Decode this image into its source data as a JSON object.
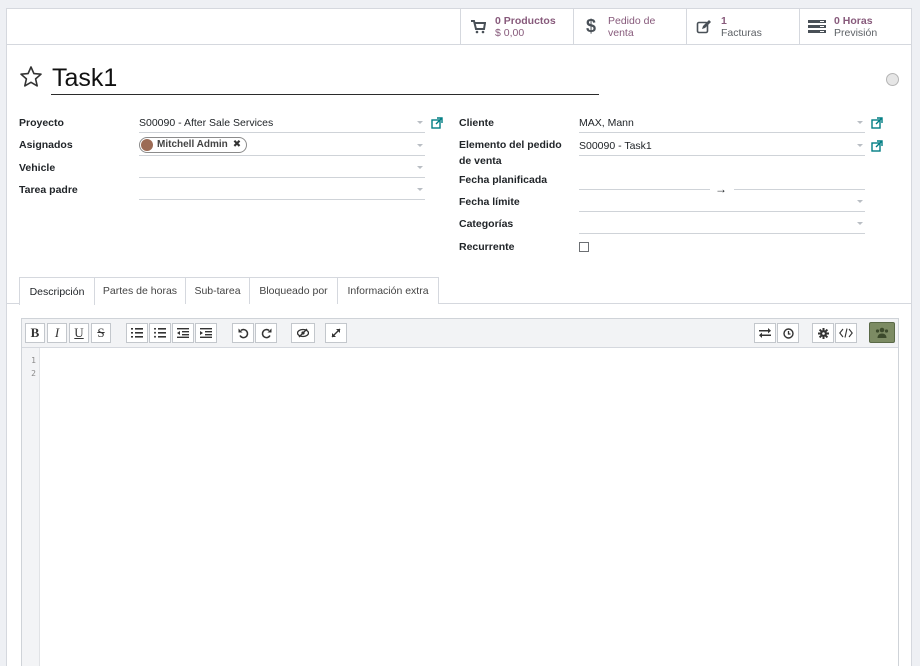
{
  "smart_buttons": {
    "products": {
      "value": "0 Productos",
      "label": "$ 0,00"
    },
    "sale_order": {
      "line1": "Pedido de",
      "line2": "venta"
    },
    "invoices": {
      "value": "1",
      "label": "Facturas"
    },
    "hours": {
      "value": "0",
      "unit": "Horas",
      "label": "Previsión"
    }
  },
  "title": "Task1",
  "fields": {
    "proyecto": {
      "label": "Proyecto",
      "value": "S00090 - After Sale Services"
    },
    "asignados": {
      "label": "Asignados",
      "tag": "Mitchell Admin"
    },
    "vehicle": {
      "label": "Vehicle",
      "value": ""
    },
    "tarea_padre": {
      "label": "Tarea padre",
      "value": ""
    },
    "cliente": {
      "label": "Cliente",
      "value": "MAX, Mann"
    },
    "elemento_pedido": {
      "label_line1": "Elemento del pedido",
      "label_line2": "de venta",
      "value": "S00090 - Task1"
    },
    "fecha_planificada": {
      "label": "Fecha planificada",
      "start": "",
      "end": "",
      "separator": "→"
    },
    "fecha_limite": {
      "label": "Fecha límite",
      "value": ""
    },
    "categorias": {
      "label": "Categorías",
      "value": ""
    },
    "recurrente": {
      "label": "Recurrente",
      "checked": false
    }
  },
  "tabs": [
    {
      "label": "Descripción",
      "active": true
    },
    {
      "label": "Partes de horas",
      "active": false
    },
    {
      "label": "Sub-tarea",
      "active": false
    },
    {
      "label": "Bloqueado por",
      "active": false
    },
    {
      "label": "Información extra",
      "active": false
    }
  ],
  "editor": {
    "toolbar": {
      "bold": "B",
      "italic": "I",
      "underline": "U",
      "strike": "S"
    },
    "line_numbers": [
      "1",
      "2"
    ]
  }
}
